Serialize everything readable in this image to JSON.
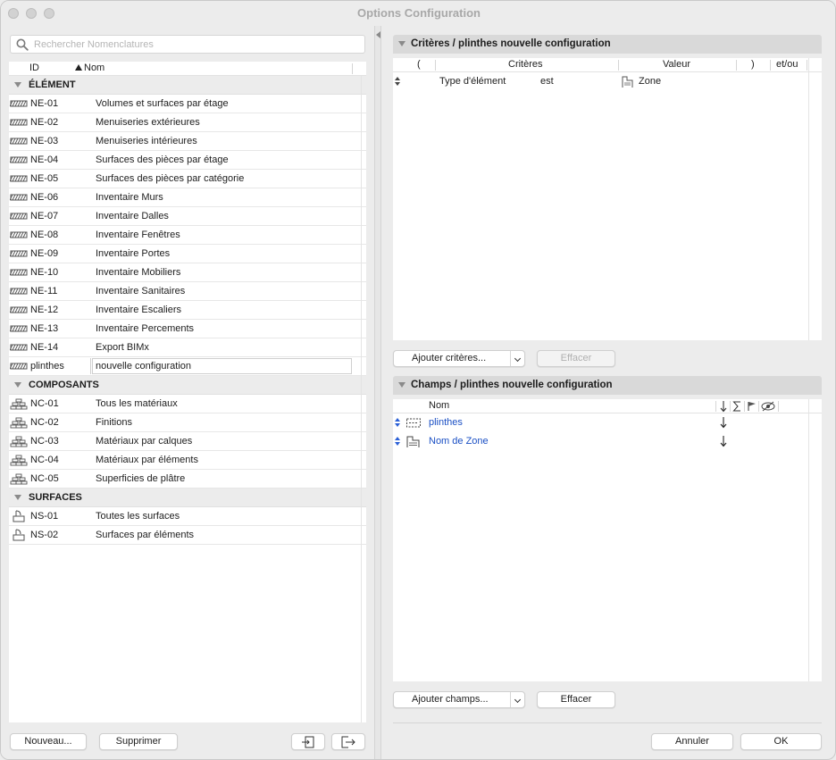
{
  "window": {
    "title": "Options Configuration"
  },
  "search": {
    "placeholder": "Rechercher Nomenclatures"
  },
  "list": {
    "col_id": "ID",
    "col_nom": "Nom",
    "groups": [
      {
        "label": "ÉLÉMENT",
        "icon": "hatch-icon",
        "items": [
          {
            "id": "NE-01",
            "nom": "Volumes et surfaces par étage"
          },
          {
            "id": "NE-02",
            "nom": "Menuiseries extérieures"
          },
          {
            "id": "NE-03",
            "nom": "Menuiseries intérieures"
          },
          {
            "id": "NE-04",
            "nom": "Surfaces des pièces par étage"
          },
          {
            "id": "NE-05",
            "nom": "Surfaces des pièces par catégorie"
          },
          {
            "id": "NE-06",
            "nom": "Inventaire Murs"
          },
          {
            "id": "NE-07",
            "nom": "Inventaire Dalles"
          },
          {
            "id": "NE-08",
            "nom": "Inventaire Fenêtres"
          },
          {
            "id": "NE-09",
            "nom": "Inventaire Portes"
          },
          {
            "id": "NE-10",
            "nom": "Inventaire Mobiliers"
          },
          {
            "id": "NE-11",
            "nom": "Inventaire Sanitaires"
          },
          {
            "id": "NE-12",
            "nom": "Inventaire Escaliers"
          },
          {
            "id": "NE-13",
            "nom": "Inventaire Percements"
          },
          {
            "id": "NE-14",
            "nom": "Export BIMx"
          }
        ],
        "editing": {
          "id": "plinthes",
          "nom": "nouvelle configuration"
        }
      },
      {
        "label": "COMPOSANTS",
        "icon": "layers-icon",
        "items": [
          {
            "id": "NC-01",
            "nom": "Tous les matériaux"
          },
          {
            "id": "NC-02",
            "nom": "Finitions"
          },
          {
            "id": "NC-03",
            "nom": "Matériaux par calques"
          },
          {
            "id": "NC-04",
            "nom": "Matériaux par éléments"
          },
          {
            "id": "NC-05",
            "nom": "Superficies de plâtre"
          }
        ]
      },
      {
        "label": "SURFACES",
        "icon": "paint-bucket-icon",
        "items": [
          {
            "id": "NS-01",
            "nom": "Toutes les surfaces"
          },
          {
            "id": "NS-02",
            "nom": "Surfaces par éléments"
          }
        ]
      }
    ]
  },
  "left_buttons": {
    "new": "Nouveau...",
    "delete": "Supprimer"
  },
  "criteria": {
    "title": "Critères / plinthes nouvelle configuration",
    "cols": {
      "open": "(",
      "criteres": "Critères",
      "valeur": "Valeur",
      "close": ")",
      "etou": "et/ou"
    },
    "row": {
      "critere": "Type d'élément",
      "op": "est",
      "valeur": "Zone"
    },
    "add_label": "Ajouter critères...",
    "clear_label": "Effacer"
  },
  "fields": {
    "title": "Champs / plinthes nouvelle configuration",
    "col_nom": "Nom",
    "rows": [
      {
        "nom": "plinthes",
        "icon": "dashed-box-icon"
      },
      {
        "nom": "Nom de Zone",
        "icon": "zone-stamp-icon"
      }
    ],
    "add_label": "Ajouter champs...",
    "clear_label": "Effacer"
  },
  "dialog_buttons": {
    "cancel": "Annuler",
    "ok": "OK"
  }
}
